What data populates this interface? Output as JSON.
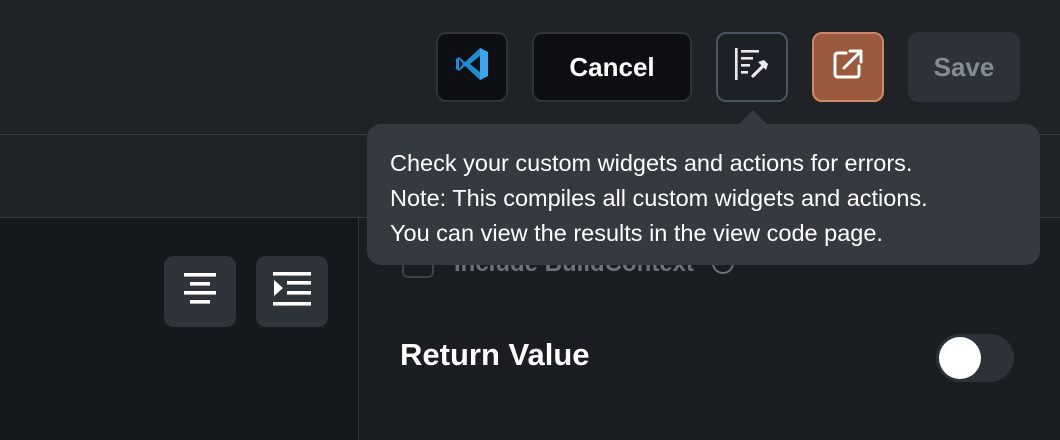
{
  "toolbar": {
    "cancel_label": "Cancel",
    "save_label": "Save",
    "vscode_icon": "vscode-icon",
    "check_icon": "check-errors-icon",
    "export_icon": "open-external-icon"
  },
  "tooltip": {
    "lines": [
      "Check your custom widgets and actions for errors.",
      "Note: This compiles all custom widgets and actions.",
      "You can view the results in the view code page."
    ]
  },
  "editor": {
    "include_build_context_label": "Include BuildContext",
    "return_value_label": "Return Value",
    "return_value_enabled": false
  },
  "colors": {
    "export_accent": "#9b5a3e",
    "vscode_blue": "#2489ca"
  }
}
